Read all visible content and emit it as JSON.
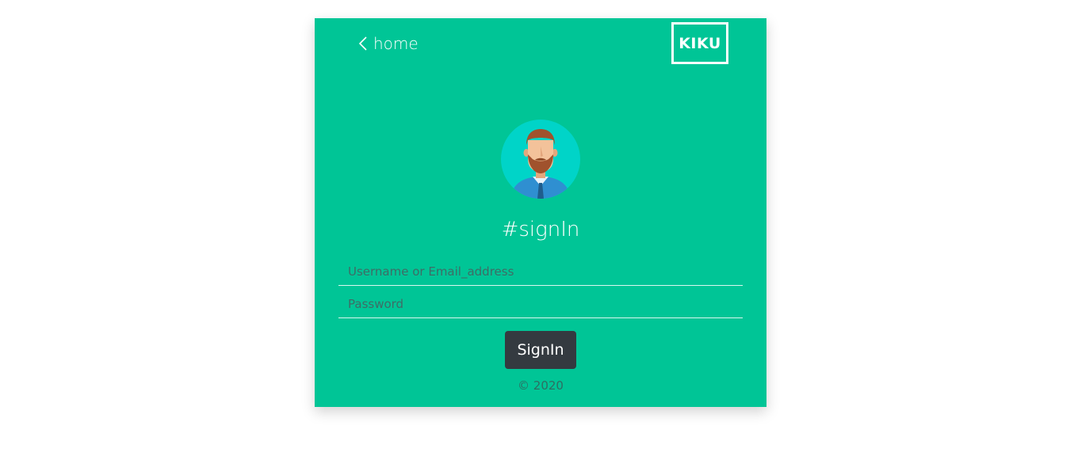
{
  "nav": {
    "home_label": "home",
    "logo_text": "KIKU"
  },
  "form": {
    "title": "#signIn",
    "username_placeholder": "Username or Email_address",
    "username_value": "",
    "password_placeholder": "Password",
    "password_value": "",
    "submit_label": "SignIn"
  },
  "footer": {
    "copyright": "© 2020"
  },
  "colors": {
    "card_background": "#00c596",
    "button_background": "#343a40",
    "avatar_circle": "#00d4c8"
  },
  "icons": {
    "back": "chevron-left-icon",
    "avatar": "bearded-man-avatar"
  }
}
